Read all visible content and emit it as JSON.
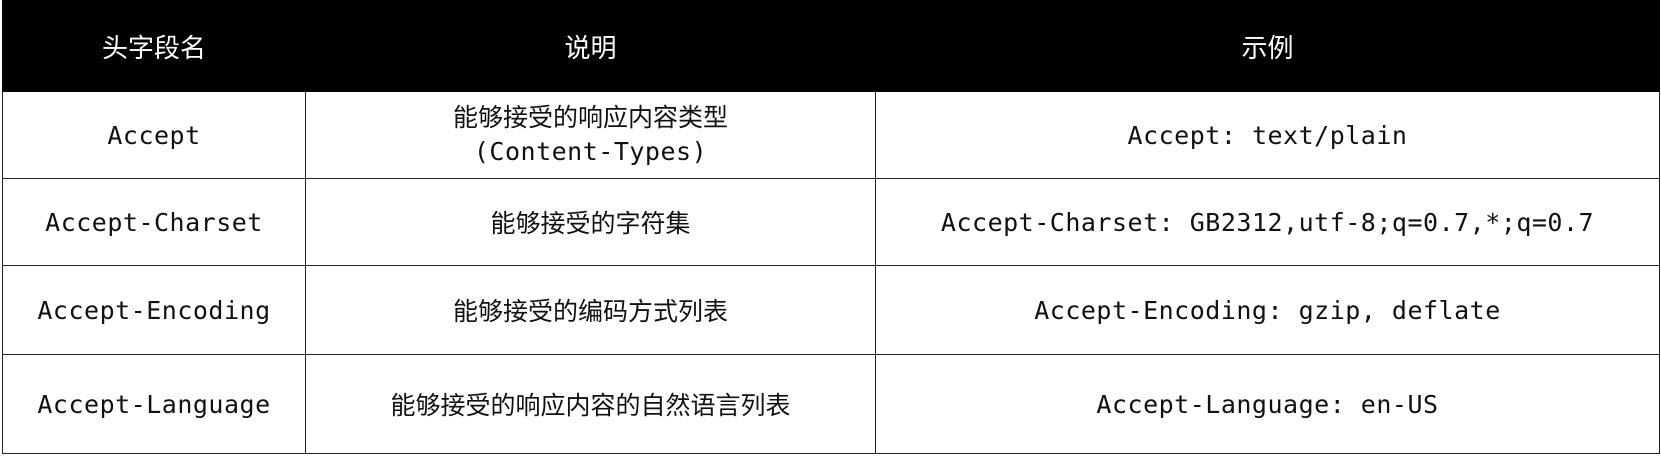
{
  "table": {
    "columns": [
      "头字段名",
      "说明",
      "示例"
    ],
    "rows": [
      {
        "name": "Accept",
        "desc_line1": "能够接受的响应内容类型",
        "desc_line2": "(Content-Types)",
        "example": "Accept: text/plain"
      },
      {
        "name": "Accept-Charset",
        "desc": "能够接受的字符集",
        "example": "Accept-Charset: GB2312,utf-8;q=0.7,*;q=0.7"
      },
      {
        "name": "Accept-Encoding",
        "desc": "能够接受的编码方式列表",
        "example": "Accept-Encoding: gzip, deflate"
      },
      {
        "name": "Accept-Language",
        "desc": "能够接受的响应内容的自然语言列表",
        "example": "Accept-Language: en-US"
      }
    ]
  },
  "colors": {
    "header_bg": "#000000",
    "header_text": "#ffffff",
    "border": "#222222",
    "body_text": "#111111"
  }
}
